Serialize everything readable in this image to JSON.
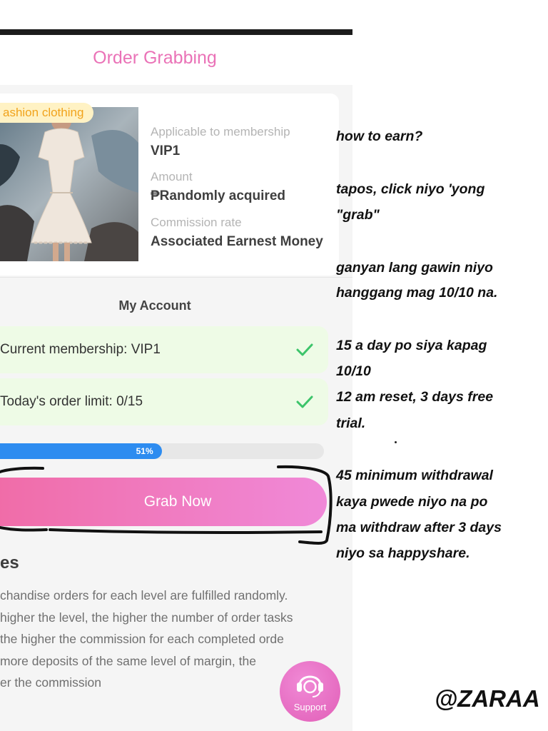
{
  "header": {
    "title": "Order Grabbing"
  },
  "product": {
    "tag": "ashion clothing",
    "membership_label": "Applicable to membership",
    "membership_value": "VIP1",
    "amount_label": "Amount",
    "amount_value": "₱Randomly acquired",
    "commission_label": "Commission rate",
    "commission_value": "Associated Earnest Money"
  },
  "account": {
    "title": "My Account",
    "membership_status": "Current membership: VIP1",
    "order_limit": "Today's order limit: 0/15"
  },
  "progress": {
    "percent": 51,
    "label": "51%"
  },
  "grab_button": "Grab Now",
  "rules": {
    "title": "es",
    "lines": [
      "chandise orders for each level are fulfilled randomly.",
      "higher the level, the higher the number of order tasks",
      "the higher the commission for each completed orde",
      "more deposits of the same level of margin, the",
      "er the commission"
    ]
  },
  "support": {
    "label": "Support"
  },
  "notes": [
    "how to earn?",
    "tapos, click niyo 'yong",
    "\"grab\"",
    "ganyan lang gawin niyo",
    "hanggang mag 10/10 na.",
    "15 a day po siya kapag",
    "10/10",
    "12 am reset, 3 days free",
    "trial.",
    "45 minimum withdrawal",
    "kaya pwede niyo na po",
    "ma withdraw after 3 days",
    "niyo sa happyshare."
  ],
  "handle": "@ZARAA",
  "colors": {
    "accent_pink": "#ea72b7",
    "progress_blue": "#2d8cf0",
    "check_green": "#3cc46a",
    "tag_orange": "#f1a31c"
  }
}
